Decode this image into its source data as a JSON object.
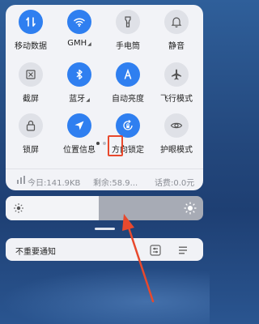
{
  "control_center": {
    "tiles": [
      {
        "label": "移动数据",
        "icon": "mobile-data-icon",
        "active": true
      },
      {
        "label": "GMH",
        "icon": "wifi-icon",
        "active": true,
        "expandable": true
      },
      {
        "label": "手电筒",
        "icon": "flashlight-icon",
        "active": false
      },
      {
        "label": "静音",
        "icon": "bell-icon",
        "active": false
      },
      {
        "label": "截屏",
        "icon": "screenshot-icon",
        "active": false
      },
      {
        "label": "蓝牙",
        "icon": "bluetooth-icon",
        "active": true,
        "expandable": true
      },
      {
        "label": "自动亮度",
        "icon": "auto-brightness-icon",
        "active": true
      },
      {
        "label": "飞行模式",
        "icon": "airplane-icon",
        "active": false
      },
      {
        "label": "锁屏",
        "icon": "lock-icon",
        "active": false
      },
      {
        "label": "位置信息",
        "icon": "location-icon",
        "active": true
      },
      {
        "label": "方向锁定",
        "icon": "rotation-lock-icon",
        "active": true
      },
      {
        "label": "护眼模式",
        "icon": "eye-icon",
        "active": false
      }
    ],
    "pagination": {
      "pages": 2,
      "current": 1
    },
    "data_usage": {
      "today": "今日:141.9KB",
      "remaining": "剩余:58.9...",
      "fee": "话费:0.0元"
    }
  },
  "brightness": {
    "level": 0.47
  },
  "notifications": {
    "unimportant_label": "不重要通知"
  },
  "colors": {
    "accent": "#2f7ff0",
    "annotation": "#e8492d"
  }
}
